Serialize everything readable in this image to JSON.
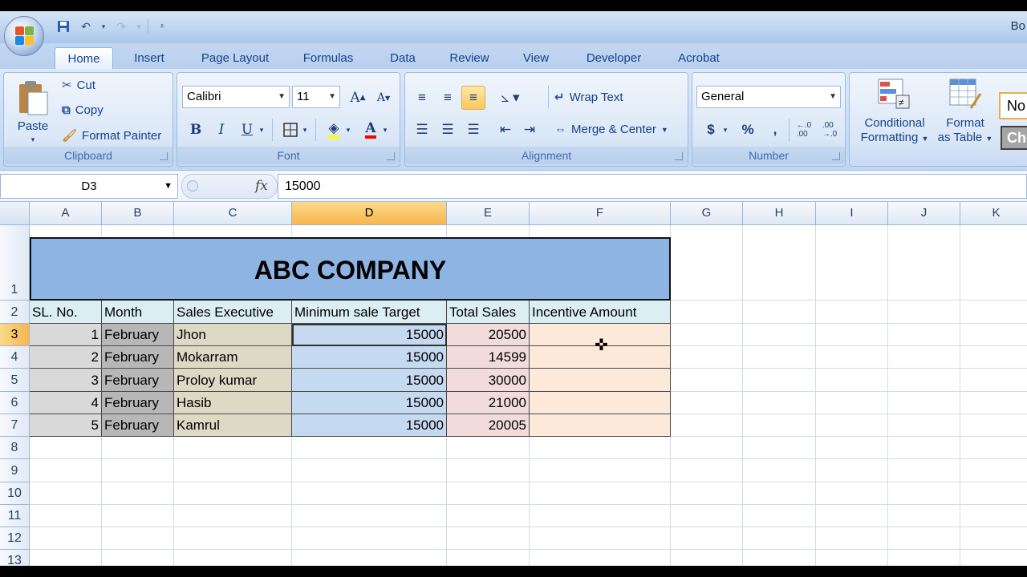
{
  "window": {
    "title": "Bo"
  },
  "qat": {
    "save": "save-icon",
    "undo": "undo-icon",
    "redo": "redo-icon"
  },
  "tabs": [
    {
      "label": "Home",
      "active": true
    },
    {
      "label": "Insert"
    },
    {
      "label": "Page Layout"
    },
    {
      "label": "Formulas"
    },
    {
      "label": "Data"
    },
    {
      "label": "Review"
    },
    {
      "label": "View"
    },
    {
      "label": "Developer"
    },
    {
      "label": "Acrobat"
    }
  ],
  "ribbon": {
    "clipboard": {
      "label": "Clipboard",
      "paste": "Paste",
      "cut": "Cut",
      "copy": "Copy",
      "format_painter": "Format Painter"
    },
    "font": {
      "label": "Font",
      "name": "Calibri",
      "size": "11",
      "bold": "B",
      "italic": "I",
      "underline": "U",
      "grow": "A",
      "shrink": "A",
      "color": "A"
    },
    "alignment": {
      "label": "Alignment",
      "wrap": "Wrap Text",
      "merge": "Merge & Center"
    },
    "number": {
      "label": "Number",
      "format": "General",
      "currency": "$",
      "percent": "%",
      "comma": ","
    },
    "styles": {
      "conditional_line1": "Conditional",
      "conditional_line2": "Formatting",
      "format_table_line1": "Format",
      "format_table_line2": "as Table",
      "style_normal": "No",
      "style_check": "Che"
    }
  },
  "formula_bar": {
    "name_box": "D3",
    "fx": "fx",
    "content": "15000"
  },
  "columns": [
    "A",
    "B",
    "C",
    "D",
    "E",
    "F",
    "G",
    "H",
    "I",
    "J",
    "K"
  ],
  "rows": [
    "1",
    "2",
    "3",
    "4",
    "5",
    "6",
    "7",
    "8",
    "9",
    "10",
    "11",
    "12",
    "13"
  ],
  "sheet": {
    "title": "ABC COMPANY",
    "headers": [
      "SL. No.",
      "Month",
      "Sales Executive",
      "Minimum sale Target",
      "Total Sales",
      "Incentive Amount"
    ],
    "rows": [
      [
        "1",
        "February",
        "Jhon",
        "15000",
        "20500",
        ""
      ],
      [
        "2",
        "February",
        "Mokarram",
        "15000",
        "14599",
        ""
      ],
      [
        "3",
        "February",
        "Proloy kumar",
        "15000",
        "30000",
        ""
      ],
      [
        "4",
        "February",
        "Hasib",
        "15000",
        "21000",
        ""
      ],
      [
        "5",
        "February",
        "Kamrul",
        "15000",
        "20005",
        ""
      ]
    ]
  },
  "selection": {
    "cell": "D3",
    "column": "D",
    "row": "3"
  },
  "colors": {
    "title_fill": "#8db4e2",
    "sl_fill": "#d9d9d9",
    "month_fill": "#b7b7b7",
    "exec_fill": "#ddd9c4",
    "target_fill": "#c5d9f1",
    "sales_fill": "#f2dcdb",
    "incentive_fill": "#fde9d9",
    "header_fill": "#dbeef4"
  }
}
